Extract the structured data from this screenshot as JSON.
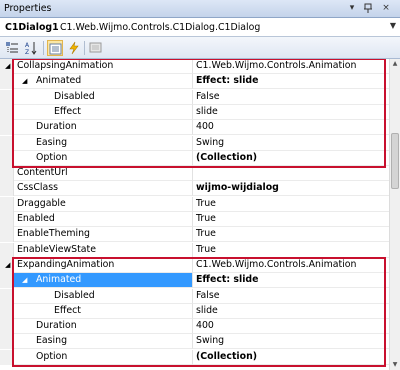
{
  "panel": {
    "title": "Properties",
    "pin_glyph": "− &#x2395;",
    "pin_icon": "pin-icon",
    "close_glyph": "×",
    "dropdown_glyph": "▾"
  },
  "selector": {
    "object_name": "C1Dialog1",
    "object_type": "C1.Web.Wijmo.Controls.C1Dialog.C1Dialog",
    "dropdown_glyph": "▼"
  },
  "toolbar": {
    "buttons": [
      {
        "name": "categorized-icon",
        "active": false
      },
      {
        "name": "alphabetical-icon",
        "active": false
      },
      {
        "name": "properties-icon",
        "active": true
      },
      {
        "name": "events-icon",
        "active": false
      },
      {
        "name": "property-pages-icon",
        "active": false
      }
    ]
  },
  "rows": [
    {
      "name": "CollapsingAnimation",
      "value": "C1.Web.Wijmo.Controls.Animation",
      "indent": 0,
      "expander": "◢",
      "bold_value": false
    },
    {
      "name": "Animated",
      "value": "Effect: slide",
      "indent": 1,
      "expander": "◢",
      "bold_value": true
    },
    {
      "name": "Disabled",
      "value": "False",
      "indent": 2,
      "expander": "",
      "bold_value": false
    },
    {
      "name": "Effect",
      "value": "slide",
      "indent": 2,
      "expander": "",
      "bold_value": false
    },
    {
      "name": "Duration",
      "value": "400",
      "indent": 1,
      "expander": "",
      "bold_value": false
    },
    {
      "name": "Easing",
      "value": "Swing",
      "indent": 1,
      "expander": "",
      "bold_value": false
    },
    {
      "name": "Option",
      "value": "(Collection)",
      "indent": 1,
      "expander": "",
      "bold_value": true
    },
    {
      "name": "ContentUrl",
      "value": "",
      "indent": 0,
      "expander": "",
      "bold_value": false
    },
    {
      "name": "CssClass",
      "value": "wijmo-wijdialog",
      "indent": 0,
      "expander": "",
      "bold_value": true
    },
    {
      "name": "Draggable",
      "value": "True",
      "indent": 0,
      "expander": "",
      "bold_value": false
    },
    {
      "name": "Enabled",
      "value": "True",
      "indent": 0,
      "expander": "",
      "bold_value": false
    },
    {
      "name": "EnableTheming",
      "value": "True",
      "indent": 0,
      "expander": "",
      "bold_value": false
    },
    {
      "name": "EnableViewState",
      "value": "True",
      "indent": 0,
      "expander": "",
      "bold_value": false
    },
    {
      "name": "ExpandingAnimation",
      "value": "C1.Web.Wijmo.Controls.Animation",
      "indent": 0,
      "expander": "◢",
      "bold_value": false
    },
    {
      "name": "Animated",
      "value": "Effect: slide",
      "indent": 1,
      "expander": "◢",
      "bold_value": true,
      "selected": true
    },
    {
      "name": "Disabled",
      "value": "False",
      "indent": 2,
      "expander": "",
      "bold_value": false
    },
    {
      "name": "Effect",
      "value": "slide",
      "indent": 2,
      "expander": "",
      "bold_value": false
    },
    {
      "name": "Duration",
      "value": "400",
      "indent": 1,
      "expander": "",
      "bold_value": false
    },
    {
      "name": "Easing",
      "value": "Swing",
      "indent": 1,
      "expander": "",
      "bold_value": false
    },
    {
      "name": "Option",
      "value": "(Collection)",
      "indent": 1,
      "expander": "",
      "bold_value": true
    }
  ],
  "highlight_color": "#c8102e",
  "selection_color": "#3399ff"
}
